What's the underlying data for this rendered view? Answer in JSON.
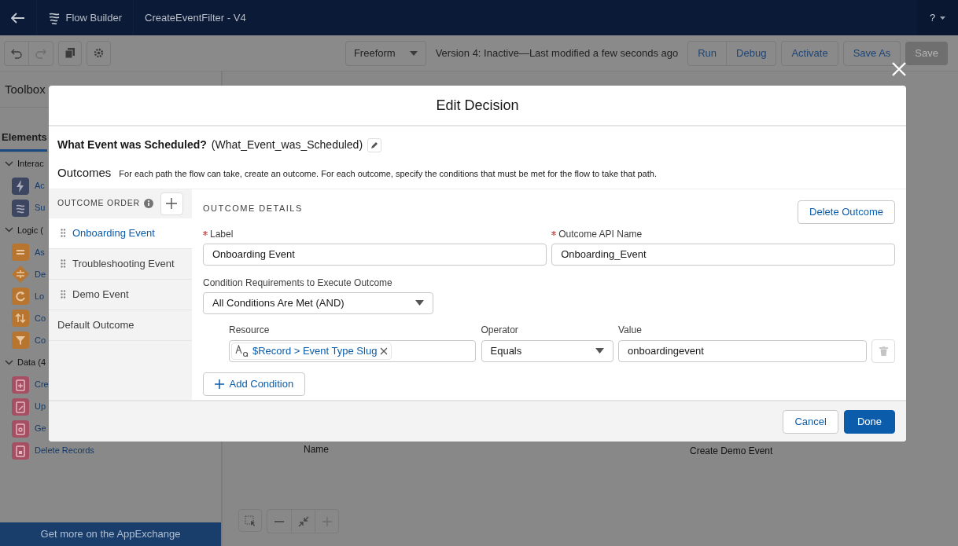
{
  "header": {
    "title": "Flow Builder",
    "flow_name": "CreateEventFilter - V4",
    "help": "?"
  },
  "toolbar": {
    "layout": "Freeform",
    "status": "Version 4: Inactive—Last modified a few seconds ago",
    "buttons": [
      {
        "label": "Run",
        "disabled": false
      },
      {
        "label": "Debug",
        "disabled": false
      },
      {
        "label": "Activate",
        "disabled": false
      },
      {
        "label": "Save As",
        "disabled": false
      },
      {
        "label": "Save",
        "disabled": true
      }
    ]
  },
  "toolbox": {
    "title": "Toolbox",
    "tab": "Elements",
    "sections": [
      {
        "label": "Interac",
        "expanded": true,
        "items": [
          {
            "label": "Ac",
            "kind": "action"
          },
          {
            "label": "Su",
            "kind": "subflow"
          }
        ]
      },
      {
        "label": "Logic (",
        "expanded": true,
        "items": [
          {
            "label": "As",
            "kind": "assignment"
          },
          {
            "label": "De",
            "kind": "decision"
          },
          {
            "label": "Lo",
            "kind": "loop"
          },
          {
            "label": "Co",
            "kind": "collection-sort"
          },
          {
            "label": "Co",
            "kind": "collection-filter"
          }
        ]
      },
      {
        "label": "Data (4",
        "expanded": true,
        "items": [
          {
            "label": "Cre",
            "kind": "create"
          },
          {
            "label": "Up",
            "kind": "update"
          },
          {
            "label": "Ge",
            "kind": "get"
          },
          {
            "label": "Delete Records",
            "kind": "delete"
          }
        ]
      }
    ],
    "footer": "Get more on the AppExchange"
  },
  "canvas": {
    "labels": [
      "Name",
      "Create Demo Event"
    ]
  },
  "modal": {
    "title": "Edit Decision",
    "element_label": "What Event was Scheduled?",
    "api_name": "(What_Event_was_Scheduled)",
    "outcomes_heading": "Outcomes",
    "outcomes_help": "For each path the flow can take, create an outcome. For each outcome, specify the conditions that must be met for the flow to take that path.",
    "order_heading": "OUTCOME ORDER",
    "outcomes": [
      {
        "label": "Onboarding Event",
        "selected": true,
        "draggable": true
      },
      {
        "label": "Troubleshooting Event",
        "selected": false,
        "draggable": true
      },
      {
        "label": "Demo Event",
        "selected": false,
        "draggable": true
      },
      {
        "label": "Default Outcome",
        "selected": false,
        "draggable": false
      }
    ],
    "details": {
      "heading": "OUTCOME DETAILS",
      "delete_button": "Delete Outcome",
      "fields": [
        {
          "label": "Label",
          "required": true,
          "value": "Onboarding Event"
        },
        {
          "label": "Outcome API Name",
          "required": true,
          "value": "Onboarding_Event"
        }
      ],
      "requirement": {
        "label": "Condition Requirements to Execute Outcome",
        "value": "All Conditions Are Met (AND)"
      },
      "column_labels": {
        "resource": "Resource",
        "operator": "Operator",
        "value": "Value"
      },
      "conditions": [
        {
          "resource": "$Record > Event Type Slug",
          "operator": "Equals",
          "value": "onboardingevent"
        }
      ],
      "add_condition": "Add Condition"
    },
    "buttons": {
      "cancel": "Cancel",
      "done": "Done"
    }
  }
}
